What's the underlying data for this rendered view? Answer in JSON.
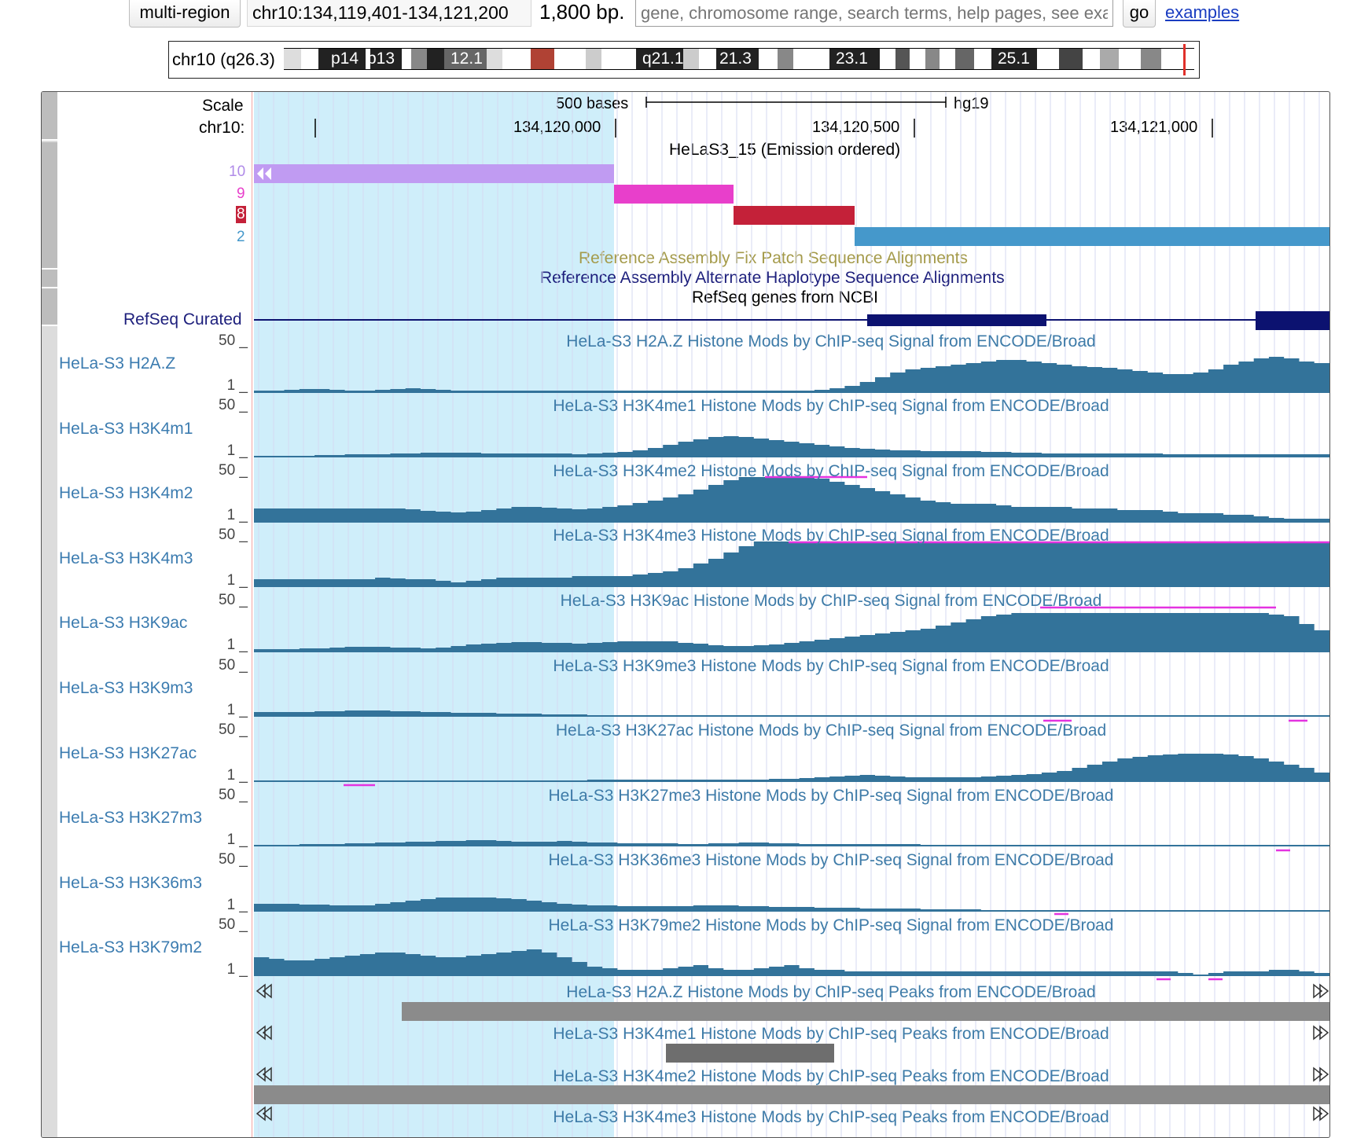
{
  "nav": {
    "multi_region_label": "multi-region",
    "position": "chr10:134,119,401-134,121,200",
    "size": "1,800 bp.",
    "search_placeholder": "gene, chromosome range, search terms, help pages, see examples",
    "go_label": "go",
    "examples_label": "examples"
  },
  "ideogram": {
    "label": "chr10 (q26.3)",
    "bands": [
      "p14",
      "p13",
      "12.1",
      "q21.1",
      "21.3",
      "23.1",
      "25.1"
    ]
  },
  "ruler": {
    "scale_label": "Scale",
    "chrom_label": "chr10:",
    "scale_bar_text": "500 bases",
    "assembly": "hg19",
    "ticks": [
      "134,120,000",
      "134,120,500",
      "134,121,000"
    ]
  },
  "chromhmm": {
    "title": "HeLaS3_15 (Emission ordered)",
    "state_labels": [
      "10",
      "9",
      "8",
      "2"
    ],
    "state_colors": [
      "#c09bf2",
      "#e83fcb",
      "#c42139",
      "#4598cb"
    ]
  },
  "feature_titles": {
    "fix_patch": "Reference Assembly Fix Patch Sequence Alignments",
    "alt_haplotype": "Reference Assembly Alternate Haplotype Sequence Alignments",
    "refseq": "RefSeq genes from NCBI"
  },
  "refseq_label": "RefSeq Curated",
  "signal_tracks": [
    {
      "label": "HeLa-S3 H2A.Z",
      "title": "HeLa-S3 H2A.Z Histone Mods by ChIP-seq Signal from ENCODE/Broad",
      "max": "50 _",
      "min": "1 _"
    },
    {
      "label": "HeLa-S3 H3K4m1",
      "title": "HeLa-S3 H3K4me1 Histone Mods by ChIP-seq Signal from ENCODE/Broad",
      "max": "50 _",
      "min": "1 _"
    },
    {
      "label": "HeLa-S3 H3K4m2",
      "title": "HeLa-S3 H3K4me2 Histone Mods by ChIP-seq Signal from ENCODE/Broad",
      "max": "50 _",
      "min": "1 _"
    },
    {
      "label": "HeLa-S3 H3K4m3",
      "title": "HeLa-S3 H3K4me3 Histone Mods by ChIP-seq Signal from ENCODE/Broad",
      "max": "50 _",
      "min": "1 _"
    },
    {
      "label": "HeLa-S3 H3K9ac",
      "title": "HeLa-S3 H3K9ac Histone Mods by ChIP-seq Signal from ENCODE/Broad",
      "max": "50 _",
      "min": "1 _"
    },
    {
      "label": "HeLa-S3 H3K9m3",
      "title": "HeLa-S3 H3K9me3 Histone Mods by ChIP-seq Signal from ENCODE/Broad",
      "max": "50 _",
      "min": "1 _"
    },
    {
      "label": "HeLa-S3 H3K27ac",
      "title": "HeLa-S3 H3K27ac Histone Mods by ChIP-seq Signal from ENCODE/Broad",
      "max": "50 _",
      "min": "1 _"
    },
    {
      "label": "HeLa-S3 H3K27m3",
      "title": "HeLa-S3 H3K27me3 Histone Mods by ChIP-seq Signal from ENCODE/Broad",
      "max": "50 _",
      "min": "1 _"
    },
    {
      "label": "HeLa-S3 H3K36m3",
      "title": "HeLa-S3 H3K36me3 Histone Mods by ChIP-seq Signal from ENCODE/Broad",
      "max": "50 _",
      "min": "1 _"
    },
    {
      "label": "HeLa-S3 H3K79m2",
      "title": "HeLa-S3 H3K79me2 Histone Mods by ChIP-seq Signal from ENCODE/Broad",
      "max": "50 _",
      "min": "1 _"
    }
  ],
  "peak_tracks": [
    {
      "title": "HeLa-S3 H2A.Z Histone Mods by ChIP-seq Peaks from ENCODE/Broad"
    },
    {
      "title": "HeLa-S3 H3K4me1 Histone Mods by ChIP-seq Peaks from ENCODE/Broad"
    },
    {
      "title": "HeLa-S3 H3K4me2 Histone Mods by ChIP-seq Peaks from ENCODE/Broad"
    },
    {
      "title": "HeLa-S3 H3K4me3 Histone Mods by ChIP-seq Peaks from ENCODE/Broad"
    }
  ],
  "colors": {
    "signal": "#33739a",
    "clip": "#e433e0",
    "refseq": "#0c1270",
    "fix_patch": "#a49a4a",
    "alt_haplotype": "#1d1f7c",
    "peak": "#8b8b8b",
    "highlight": "#cfeefa"
  }
}
